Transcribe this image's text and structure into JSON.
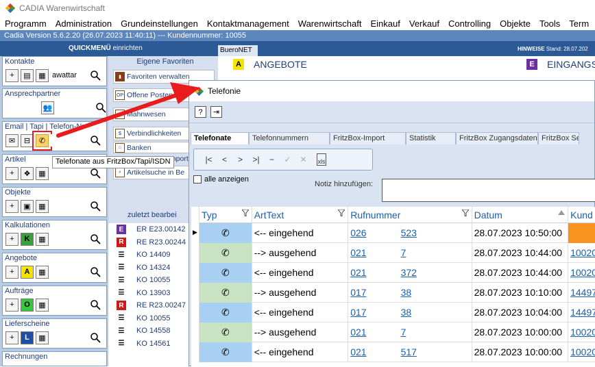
{
  "app": {
    "title": "CADIA Warenwirtschaft"
  },
  "menu": [
    "Programm",
    "Administration",
    "Grundeinstellungen",
    "Kontaktmanagement",
    "Warenwirtschaft",
    "Einkauf",
    "Verkauf",
    "Controlling",
    "Objekte",
    "Tools",
    "Term"
  ],
  "version_bar": "Cadia Version 5.6.2.20  (26.07.2023 11:40:11) --- Kundennummer: 10055",
  "quickmenu": {
    "title": "QUICKMENÜ",
    "action": "einrichten",
    "tab": "BueroNET",
    "hinweise": "HINWEISE",
    "stand": "Stand: 28.07.202"
  },
  "sidebar": [
    {
      "label": "Kontakte",
      "value": "awattar"
    },
    {
      "label": "Ansprechpartner",
      "value": ""
    },
    {
      "label": "Email | Tapi | Telefon-Nr",
      "value": ""
    },
    {
      "label": "Artikel",
      "value": ""
    },
    {
      "label": "Objekte",
      "value": ""
    },
    {
      "label": "Kalkulationen",
      "value": ""
    },
    {
      "label": "Angebote",
      "value": ""
    },
    {
      "label": "Aufträge",
      "value": ""
    },
    {
      "label": "Lieferscheine",
      "value": ""
    },
    {
      "label": "Rechnungen",
      "value": ""
    }
  ],
  "favorites": {
    "header": "Eigene Favoriten",
    "items": [
      "Favoriten verwalten",
      "Offene Posten",
      "Mahnwesen",
      "Verbindlichkeiten",
      "Banken",
      "Import",
      "Artikelsuche in Be"
    ]
  },
  "recent": {
    "header": "zuletzt  bearbei",
    "items": [
      {
        "badge": "E",
        "text": "ER E23.00142"
      },
      {
        "badge": "R",
        "text": "RE R23.00244"
      },
      {
        "badge": "K",
        "text": "KO 14409"
      },
      {
        "badge": "K",
        "text": "KO 14324"
      },
      {
        "badge": "K",
        "text": "KO 10055"
      },
      {
        "badge": "K",
        "text": "KO 13903"
      },
      {
        "badge": "R",
        "text": "RE R23.00247"
      },
      {
        "badge": "K",
        "text": "KO 10055"
      },
      {
        "badge": "K",
        "text": "KO 14558"
      },
      {
        "badge": "K",
        "text": "KO 14561"
      }
    ]
  },
  "tiles": {
    "angebote": "ANGEBOTE",
    "eingang": "EINGANGS"
  },
  "tooltip": "Telefonate aus FritzBox/Tapi/ISDN",
  "dialog": {
    "title": "Telefonie",
    "tabs": [
      "Telefonate",
      "Telefonnummern",
      "FritzBox-Import",
      "Statistik",
      "FritzBox Zugangsdaten",
      "FritzBox Se"
    ],
    "show_all": "alle anzeigen",
    "notiz_label": "Notiz hinzufügen:",
    "columns": [
      "Typ",
      "ArtText",
      "Rufnummer",
      "Datum",
      "Kund"
    ],
    "rows": [
      {
        "type": "in",
        "art": "<-- eingehend",
        "nr_a": "026",
        "nr_b": "523",
        "datum": "28.07.2023 10:50:00",
        "kunde": ""
      },
      {
        "type": "out",
        "art": "--> ausgehend",
        "nr_a": "021",
        "nr_b": "7",
        "datum": "28.07.2023 10:44:00",
        "kunde": "10020"
      },
      {
        "type": "in",
        "art": "<-- eingehend",
        "nr_a": "021",
        "nr_b": "372",
        "datum": "28.07.2023 10:44:00",
        "kunde": "10020"
      },
      {
        "type": "out",
        "art": "--> ausgehend",
        "nr_a": "017",
        "nr_b": "38",
        "datum": "28.07.2023 10:10:00",
        "kunde": "14497"
      },
      {
        "type": "in",
        "art": "<-- eingehend",
        "nr_a": "017",
        "nr_b": "38",
        "datum": "28.07.2023 10:04:00",
        "kunde": "14497"
      },
      {
        "type": "out",
        "art": "--> ausgehend",
        "nr_a": "021",
        "nr_b": "7",
        "datum": "28.07.2023 10:00:00",
        "kunde": "10020"
      },
      {
        "type": "in",
        "art": "<-- eingehend",
        "nr_a": "021",
        "nr_b": "517",
        "datum": "28.07.2023 10:00:00",
        "kunde": "10020"
      }
    ]
  },
  "colors": {
    "accent": "#2c5a96",
    "highlight": "#ffd36b",
    "arrow": "#e81c1c",
    "incoming": "#a8d0f3",
    "outgoing": "#c8e3c1"
  }
}
